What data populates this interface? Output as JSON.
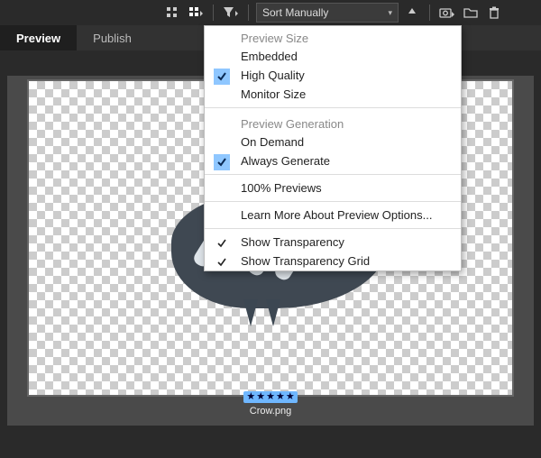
{
  "toolbar": {
    "sort_label": "Sort Manually"
  },
  "tabs": {
    "preview": "Preview",
    "publish": "Publish"
  },
  "menu": {
    "group1_title": "Preview Size",
    "embedded": "Embedded",
    "high_quality": "High Quality",
    "monitor_size": "Monitor Size",
    "group2_title": "Preview Generation",
    "on_demand": "On Demand",
    "always_generate": "Always Generate",
    "hundred": "100% Previews",
    "learn_more": "Learn More About Preview Options...",
    "show_transparency": "Show Transparency",
    "show_transparency_grid": "Show Transparency Grid"
  },
  "file": {
    "name": "Crow.png",
    "rating": 5
  }
}
